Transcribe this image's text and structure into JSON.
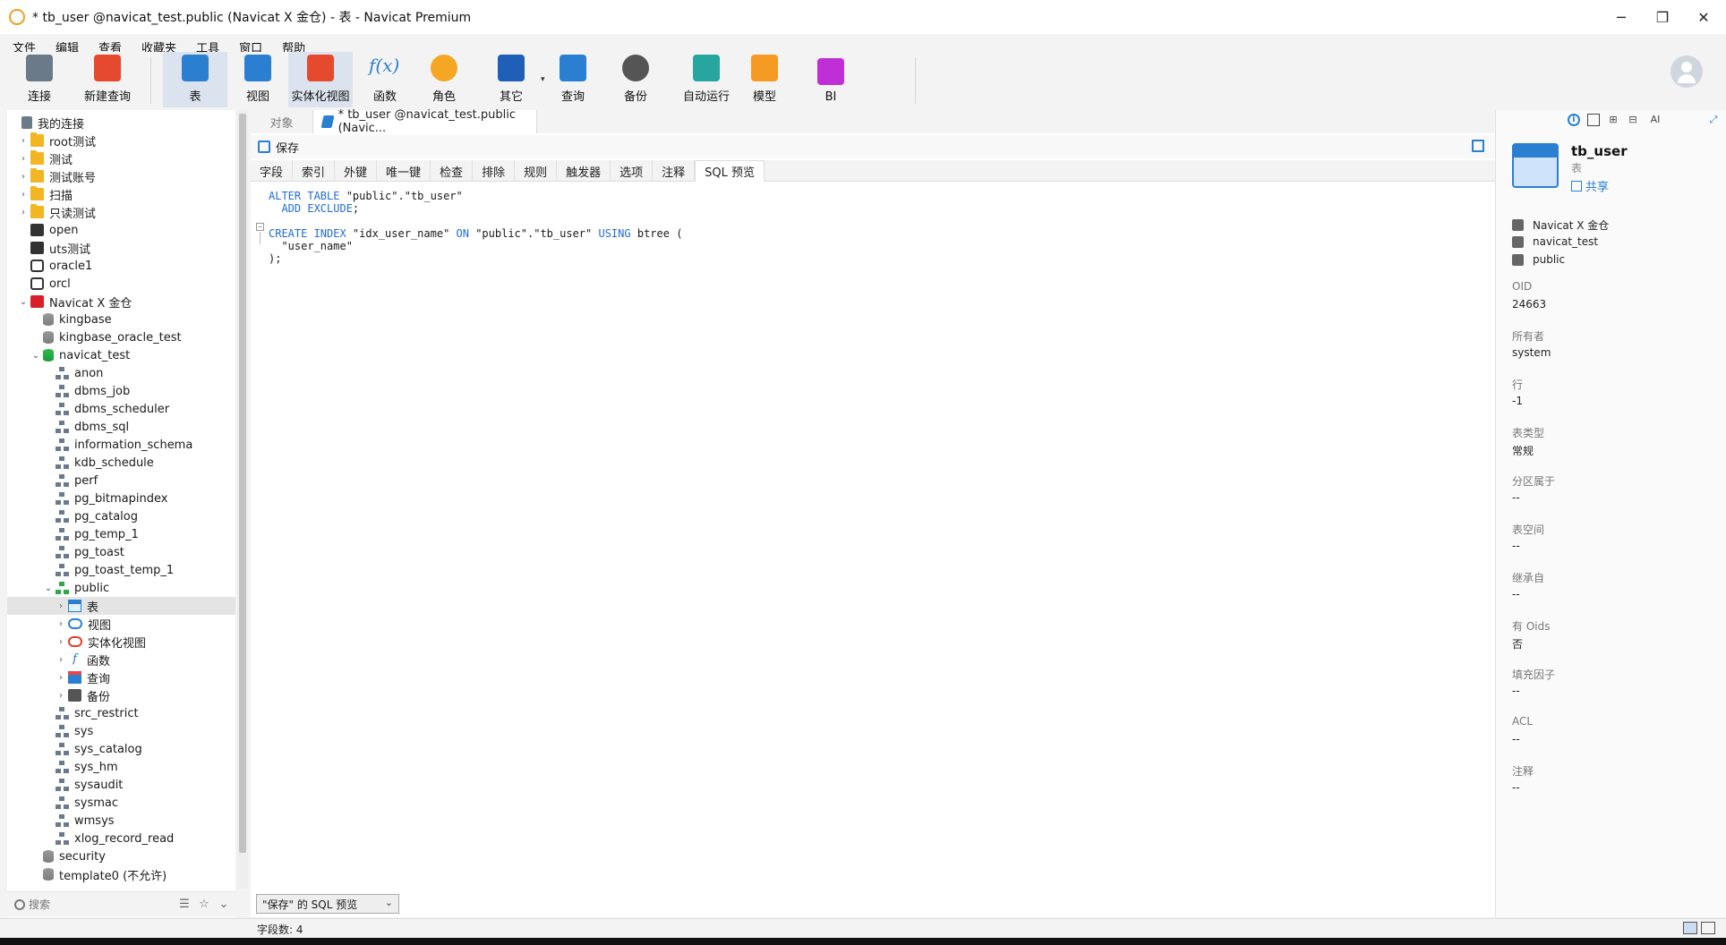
{
  "window": {
    "title": "* tb_user @navicat_test.public (Navicat X 金仓) - 表 - Navicat Premium",
    "controls": [
      "─",
      "❐",
      "✕"
    ]
  },
  "menu": [
    "文件",
    "编辑",
    "查看",
    "收藏夹",
    "工具",
    "窗口",
    "帮助"
  ],
  "toolbar": {
    "buttons": [
      {
        "label": "连接",
        "icon": "plug-icon"
      },
      {
        "label": "新建查询",
        "icon": "new-query-icon"
      },
      {
        "label": "表",
        "icon": "table-icon",
        "active": true
      },
      {
        "label": "视图",
        "icon": "view-icon"
      },
      {
        "label": "实体化视图",
        "icon": "materialized-view-icon",
        "active": true
      },
      {
        "label": "函数",
        "icon": "function-icon"
      },
      {
        "label": "角色",
        "icon": "role-icon"
      },
      {
        "label": "其它",
        "icon": "tools-icon"
      },
      {
        "label": "查询",
        "icon": "query-icon"
      },
      {
        "label": "备份",
        "icon": "backup-icon"
      },
      {
        "label": "自动运行",
        "icon": "robot-icon"
      },
      {
        "label": "模型",
        "icon": "model-icon"
      },
      {
        "label": "BI",
        "icon": "bi-icon"
      }
    ]
  },
  "tree": {
    "header": "我的连接",
    "items": [
      {
        "label": "root测试",
        "icon": "folder",
        "level": 1,
        "arrow": "›"
      },
      {
        "label": "测试",
        "icon": "folder",
        "level": 1,
        "arrow": "›"
      },
      {
        "label": "测试账号",
        "icon": "folder",
        "level": 1,
        "arrow": "›"
      },
      {
        "label": "扫描",
        "icon": "folder",
        "level": 1,
        "arrow": "›"
      },
      {
        "label": "只读测试",
        "icon": "folder",
        "level": 1,
        "arrow": "›"
      },
      {
        "label": "open",
        "icon": "conn-bw",
        "level": 1,
        "arrow": ""
      },
      {
        "label": "uts测试",
        "icon": "conn-bw",
        "level": 1,
        "arrow": ""
      },
      {
        "label": "oracle1",
        "icon": "conn-oracle",
        "level": 1,
        "arrow": ""
      },
      {
        "label": "orcl",
        "icon": "conn-oracle",
        "level": 1,
        "arrow": ""
      },
      {
        "label": "Navicat X 金仓",
        "icon": "conn-kb",
        "level": 1,
        "arrow": "⌄"
      },
      {
        "label": "kingbase",
        "icon": "db-grey",
        "level": 2,
        "arrow": ""
      },
      {
        "label": "kingbase_oracle_test",
        "icon": "db-grey",
        "level": 2,
        "arrow": ""
      },
      {
        "label": "navicat_test",
        "icon": "db-green",
        "level": 2,
        "arrow": "⌄"
      },
      {
        "label": "anon",
        "icon": "schema",
        "level": 3,
        "arrow": ""
      },
      {
        "label": "dbms_job",
        "icon": "schema",
        "level": 3,
        "arrow": ""
      },
      {
        "label": "dbms_scheduler",
        "icon": "schema",
        "level": 3,
        "arrow": ""
      },
      {
        "label": "dbms_sql",
        "icon": "schema",
        "level": 3,
        "arrow": ""
      },
      {
        "label": "information_schema",
        "icon": "schema",
        "level": 3,
        "arrow": ""
      },
      {
        "label": "kdb_schedule",
        "icon": "schema",
        "level": 3,
        "arrow": ""
      },
      {
        "label": "perf",
        "icon": "schema",
        "level": 3,
        "arrow": ""
      },
      {
        "label": "pg_bitmapindex",
        "icon": "schema",
        "level": 3,
        "arrow": ""
      },
      {
        "label": "pg_catalog",
        "icon": "schema",
        "level": 3,
        "arrow": ""
      },
      {
        "label": "pg_temp_1",
        "icon": "schema",
        "level": 3,
        "arrow": ""
      },
      {
        "label": "pg_toast",
        "icon": "schema",
        "level": 3,
        "arrow": ""
      },
      {
        "label": "pg_toast_temp_1",
        "icon": "schema",
        "level": 3,
        "arrow": ""
      },
      {
        "label": "public",
        "icon": "schema schema-green",
        "level": 3,
        "arrow": "⌄"
      },
      {
        "label": "表",
        "icon": "tbl",
        "level": 4,
        "arrow": "›",
        "selected": true
      },
      {
        "label": "视图",
        "icon": "view",
        "level": 4,
        "arrow": "›"
      },
      {
        "label": "实体化视图",
        "icon": "mview",
        "level": 4,
        "arrow": "›"
      },
      {
        "label": "函数",
        "icon": "func",
        "level": 4,
        "arrow": "›",
        "glyph": "f"
      },
      {
        "label": "查询",
        "icon": "query",
        "level": 4,
        "arrow": "›"
      },
      {
        "label": "备份",
        "icon": "backup",
        "level": 4,
        "arrow": "›"
      },
      {
        "label": "src_restrict",
        "icon": "schema",
        "level": 3,
        "arrow": ""
      },
      {
        "label": "sys",
        "icon": "schema",
        "level": 3,
        "arrow": ""
      },
      {
        "label": "sys_catalog",
        "icon": "schema",
        "level": 3,
        "arrow": ""
      },
      {
        "label": "sys_hm",
        "icon": "schema",
        "level": 3,
        "arrow": ""
      },
      {
        "label": "sysaudit",
        "icon": "schema",
        "level": 3,
        "arrow": ""
      },
      {
        "label": "sysmac",
        "icon": "schema",
        "level": 3,
        "arrow": ""
      },
      {
        "label": "wmsys",
        "icon": "schema",
        "level": 3,
        "arrow": ""
      },
      {
        "label": "xlog_record_read",
        "icon": "schema",
        "level": 3,
        "arrow": ""
      },
      {
        "label": "security",
        "icon": "db-grey",
        "level": 2,
        "arrow": ""
      },
      {
        "label": "template0 (不允许)",
        "icon": "db-grey",
        "level": 2,
        "arrow": ""
      }
    ],
    "search_placeholder": "搜索"
  },
  "editor": {
    "tabs": [
      {
        "label": "对象"
      },
      {
        "label": "* tb_user @navicat_test.public (Navic..."
      }
    ],
    "save_label": "保存",
    "subtabs": [
      "字段",
      "索引",
      "外键",
      "唯一键",
      "检查",
      "排除",
      "规则",
      "触发器",
      "选项",
      "注释",
      "SQL 预览"
    ],
    "active_subtab": "SQL 预览",
    "sql_lines": [
      [
        {
          "t": "ALTER TABLE ",
          "c": "kw"
        },
        {
          "t": "\"public\".\"tb_user\"",
          "c": "str"
        }
      ],
      [
        {
          "t": "  ADD EXCLUDE",
          "c": "kw"
        },
        {
          "t": ";",
          "c": "str"
        }
      ],
      [],
      [
        {
          "t": "CREATE INDEX ",
          "c": "kw"
        },
        {
          "t": "\"idx_user_name\" ",
          "c": "str"
        },
        {
          "t": "ON ",
          "c": "kw"
        },
        {
          "t": "\"public\".\"tb_user\" ",
          "c": "str"
        },
        {
          "t": "USING ",
          "c": "kw"
        },
        {
          "t": "btree (",
          "c": "str"
        }
      ],
      [
        {
          "t": "  \"user_name\"",
          "c": "str"
        }
      ],
      [
        {
          "t": ");",
          "c": "str"
        }
      ]
    ],
    "preview_select": "\"保存\" 的 SQL 预览"
  },
  "info": {
    "name": "tb_user",
    "type": "表",
    "share_label": "共享",
    "context": [
      {
        "label": "Navicat X 金仓"
      },
      {
        "label": "navicat_test"
      },
      {
        "label": "public"
      }
    ],
    "properties": [
      {
        "label": "OID",
        "value": "24663"
      },
      {
        "label": "所有者",
        "value": "system"
      },
      {
        "label": "行",
        "value": "-1"
      },
      {
        "label": "表类型",
        "value": "常规"
      },
      {
        "label": "分区属于",
        "value": "--"
      },
      {
        "label": "表空间",
        "value": "--"
      },
      {
        "label": "继承自",
        "value": "--"
      },
      {
        "label": "有 Oids",
        "value": "否"
      },
      {
        "label": "填充因子",
        "value": "--"
      },
      {
        "label": "ACL",
        "value": "--"
      },
      {
        "label": "注释",
        "value": "--"
      }
    ],
    "toolbar_ai": "AI"
  },
  "status": {
    "field_count": "字段数: 4"
  }
}
